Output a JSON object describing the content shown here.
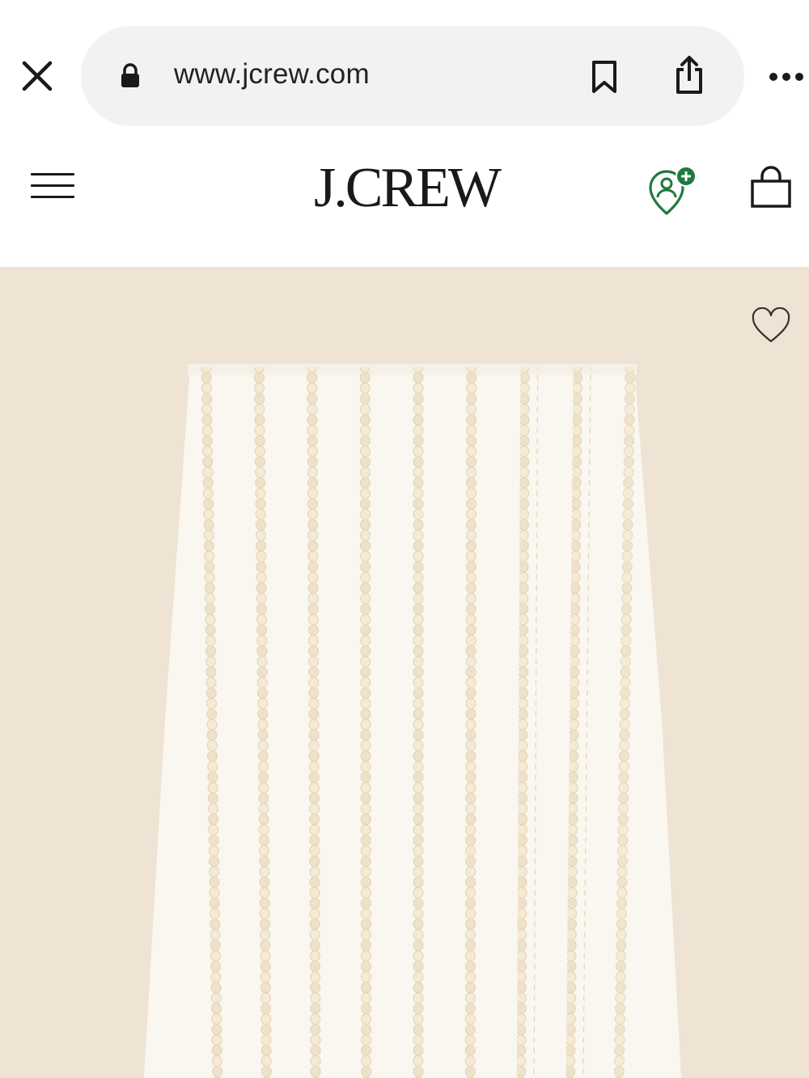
{
  "browser": {
    "url": "www.jcrew.com",
    "close_icon": "close-icon",
    "lock_icon": "lock-icon",
    "bookmark_icon": "bookmark-icon",
    "share_icon": "share-icon",
    "more_icon": "more-icon"
  },
  "header": {
    "logo_text": "J.CREW",
    "menu_icon": "hamburger-menu-icon",
    "rewards_icon": "rewards-profile-icon",
    "bag_icon": "shopping-bag-icon"
  },
  "product": {
    "wishlist_icon": "heart-icon",
    "image_alt": "sequin-striped skirt"
  },
  "colors": {
    "product_background": "#efe3d4",
    "skirt": "#faf7f1",
    "sequin": "#ede0c5",
    "rewards_accent": "#1f7a3d",
    "url_pill": "#f1f2f4"
  }
}
